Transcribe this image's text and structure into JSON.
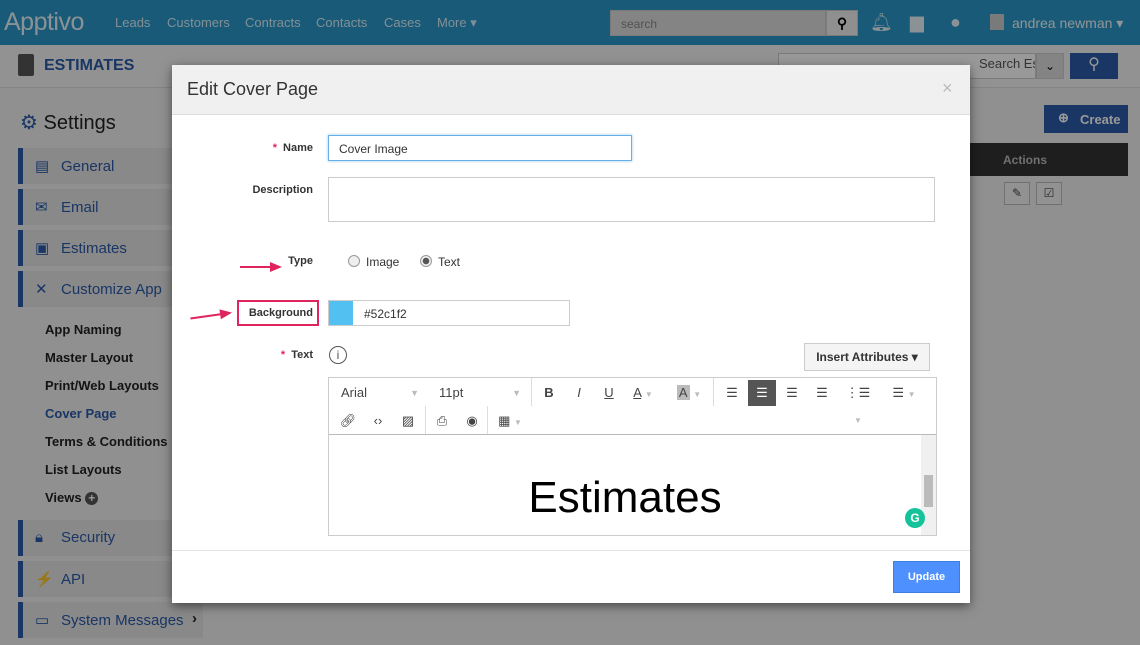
{
  "topbar": {
    "logo": "Apptivo",
    "nav": [
      "Leads",
      "Customers",
      "Contracts",
      "Contacts",
      "Cases",
      "More ▾"
    ],
    "search_placeholder": "search",
    "user": "andrea newman ▾"
  },
  "app": {
    "title": "ESTIMATES",
    "search_placeholder": "Search Estimates",
    "create": "Create",
    "actions_header": "Actions"
  },
  "sidebar": {
    "title": "Settings",
    "items": [
      {
        "label": "General",
        "icon": "monitor-icon"
      },
      {
        "label": "Email",
        "icon": "envelope-icon"
      },
      {
        "label": "Estimates",
        "icon": "window-icon"
      },
      {
        "label": "Customize App",
        "icon": "tools-icon"
      }
    ],
    "subitems": [
      "App Naming",
      "Master Layout",
      "Print/Web Layouts",
      "Cover Page",
      "Terms & Conditions",
      "List Layouts",
      "Views"
    ],
    "active_subitem": "Cover Page",
    "bottom_items": [
      {
        "label": "Security",
        "icon": "lock-icon"
      },
      {
        "label": "API",
        "icon": "plug-icon"
      },
      {
        "label": "System Messages",
        "icon": "message-icon"
      }
    ]
  },
  "modal": {
    "title": "Edit Cover Page",
    "close": "×",
    "name_label": "Name",
    "name_value": "Cover Image",
    "description_label": "Description",
    "description_value": "",
    "type_label": "Type",
    "type_options": [
      "Image",
      "Text"
    ],
    "type_selected": "Text",
    "background_label": "Background",
    "background_value": "#52c1f2",
    "text_label": "Text",
    "insert_attributes": "Insert Attributes ▾",
    "toolbar": {
      "font": "Arial",
      "size": "11pt"
    },
    "content": "Estimates",
    "update": "Update"
  },
  "colors": {
    "accent": "#2a5aa8",
    "topbar": "#2b97c8",
    "annotation": "#e0245e",
    "swatch": "#52c1f2",
    "update": "#4d90fe"
  }
}
